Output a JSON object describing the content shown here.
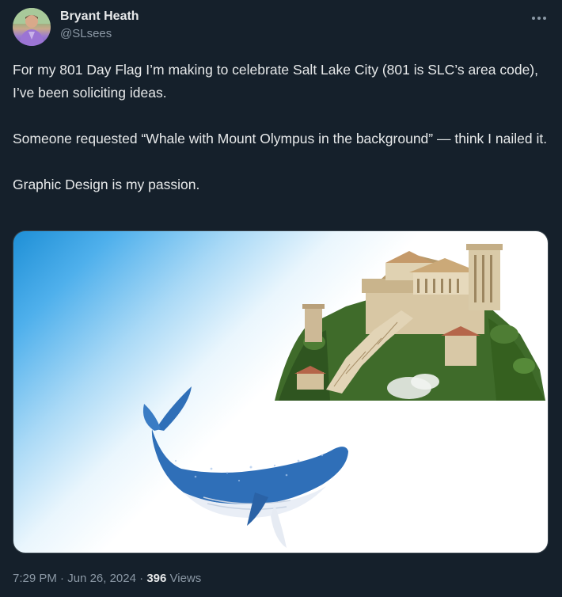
{
  "author": {
    "name": "Bryant Heath",
    "handle": "@SLsees"
  },
  "tweet": {
    "paragraphs": [
      "For my 801 Day Flag I’m making to celebrate Salt Lake City (801 is SLC’s area code), I’ve been soliciting ideas.",
      "Someone requested “Whale with Mount Olympus in the background” — think I nailed it.",
      "Graphic Design is my passion."
    ]
  },
  "meta": {
    "time": "7:29 PM",
    "separator1": " · ",
    "date": "Jun 26, 2024",
    "separator2": " · ",
    "views_count": "396",
    "views_label": " Views"
  },
  "icons": {
    "more": "more-horizontal-icon"
  },
  "colors": {
    "background": "#15202b",
    "text_primary": "#e7e9ea",
    "text_secondary": "#8b98a5",
    "whale_blue": "#2f6fb8"
  }
}
